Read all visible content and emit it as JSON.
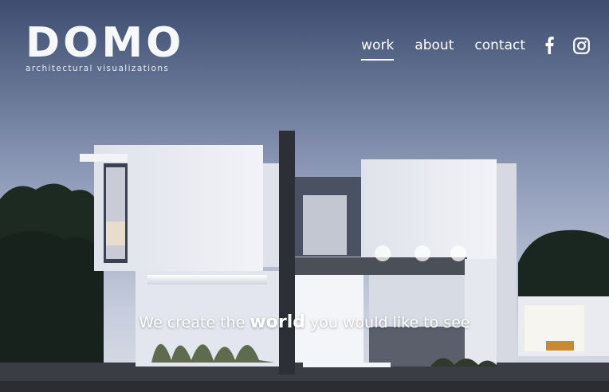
{
  "brand": {
    "name": "DOMO",
    "tagline_small": "architectural visualizations"
  },
  "nav": {
    "items": [
      {
        "label": "work",
        "active": true
      },
      {
        "label": "about",
        "active": false
      },
      {
        "label": "contact",
        "active": false
      }
    ],
    "social": [
      "facebook-icon",
      "instagram-icon"
    ]
  },
  "hero": {
    "headline_before": "We create the",
    "headline_emphasis": "world",
    "headline_after": "you would like to see"
  },
  "colors": {
    "sky_top": "#3f4f73",
    "sky_bottom": "#c9cfdc",
    "wall": "#e9ebf1",
    "nav_text": "#ffffff"
  }
}
